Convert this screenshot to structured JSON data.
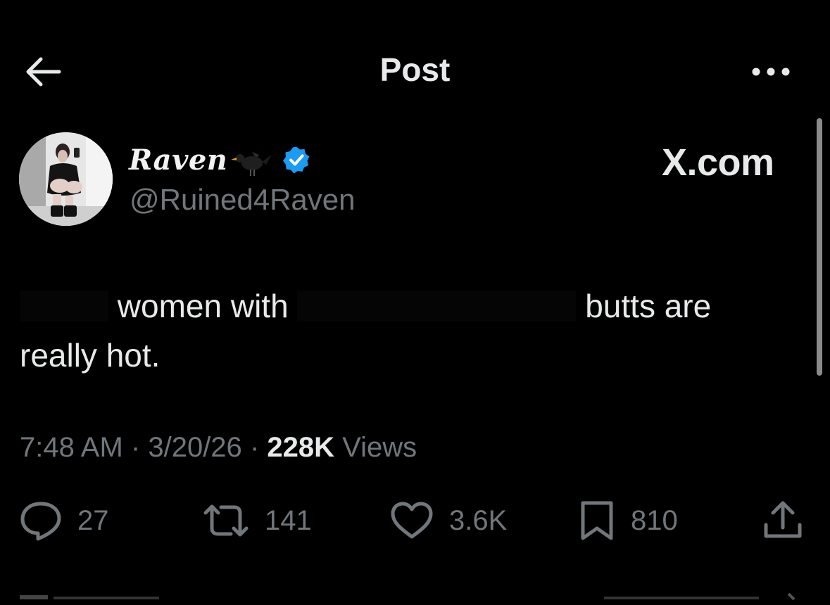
{
  "header": {
    "title": "Post",
    "back_icon": "arrow-left-icon",
    "more_icon": "more-horizontal-icon"
  },
  "author": {
    "display_name": "Raven",
    "handle": "@Ruined4Raven",
    "verified": true,
    "verified_color": "#1d9bf0",
    "emoji_icon": "blackbird-icon"
  },
  "watermark": "X.com",
  "tweet": {
    "text_part1": "women with",
    "text_part2": "butts are",
    "text_part3": "really hot."
  },
  "meta": {
    "time": "7:48 AM",
    "separator": "·",
    "date": "3/20/26",
    "views_count": "228K",
    "views_label": "Views"
  },
  "actions": {
    "replies": "27",
    "reposts": "141",
    "likes": "3.6K",
    "bookmarks": "810"
  },
  "colors": {
    "background": "#000000",
    "primary_text": "#e7e9ea",
    "secondary_text": "#71767b",
    "accent": "#1d9bf0"
  }
}
